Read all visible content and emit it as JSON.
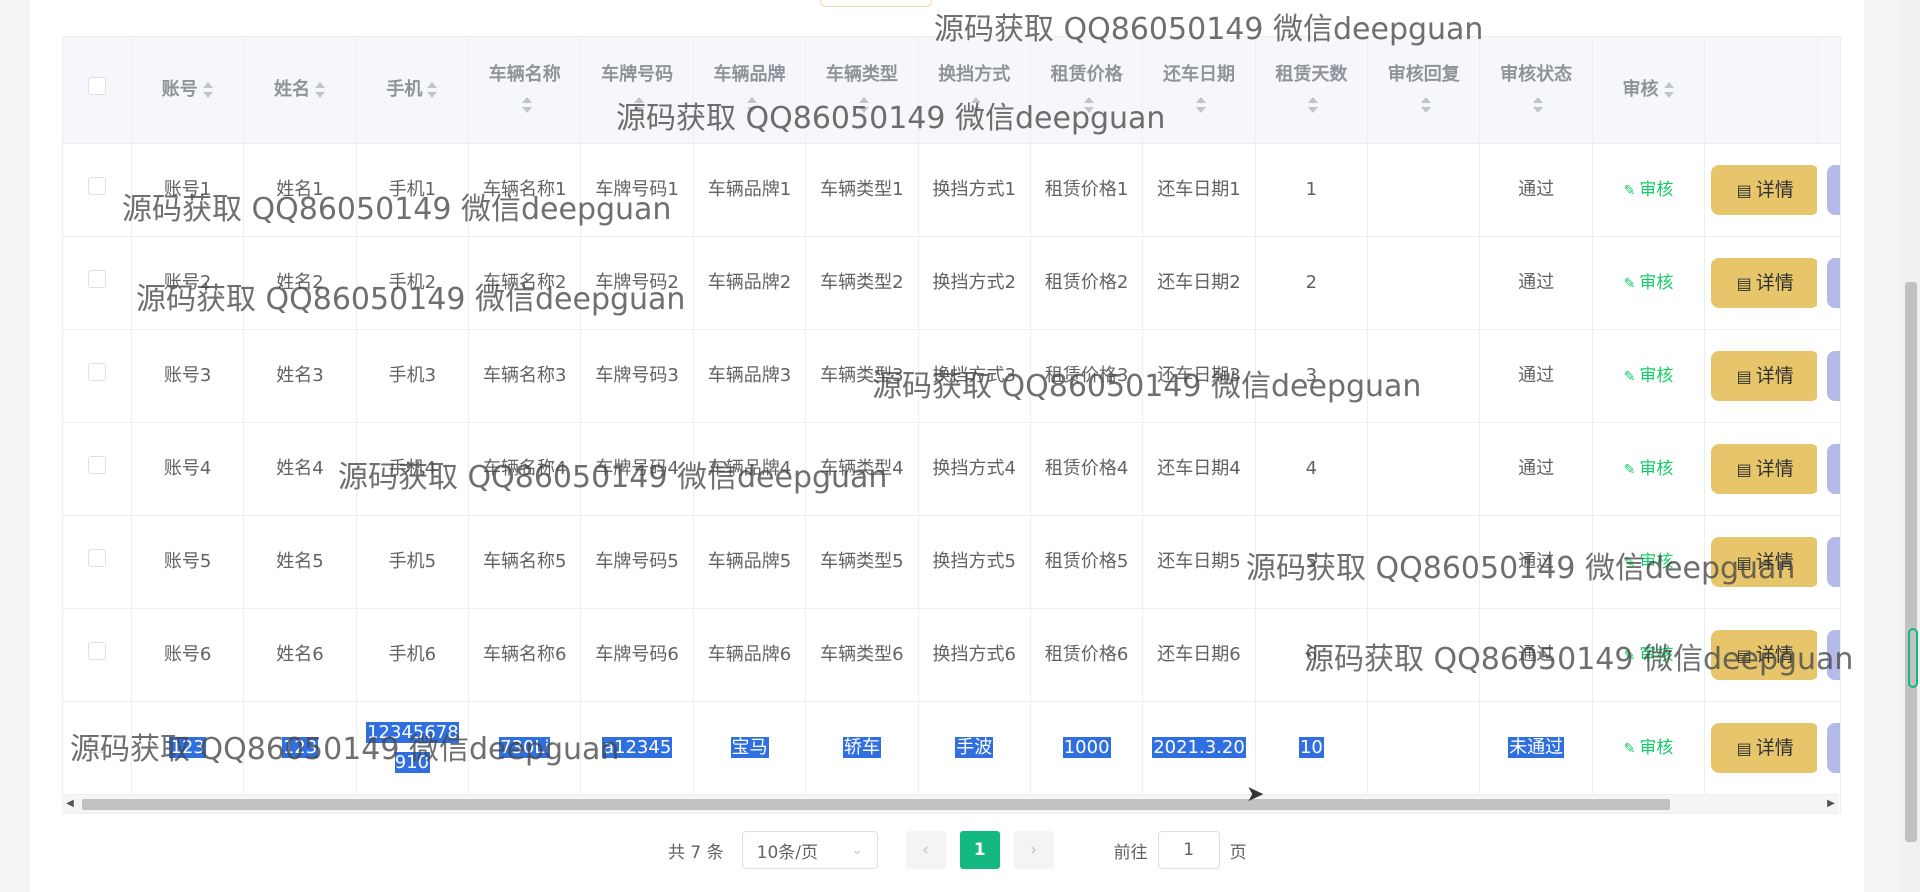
{
  "table": {
    "headers": {
      "account": "账号",
      "name": "姓名",
      "phone": "手机",
      "vehicle_name": "车辆名称",
      "plate": "车牌号码",
      "brand": "车辆品牌",
      "type": "车辆类型",
      "gear": "换挡方式",
      "price": "租赁价格",
      "return_date": "还车日期",
      "days": "租赁天数",
      "reply": "审核回复",
      "status": "审核状态",
      "audit": "审核"
    },
    "rows": [
      {
        "account": "账号1",
        "name": "姓名1",
        "phone": "手机1",
        "vehicle_name": "车辆名称1",
        "plate": "车牌号码1",
        "brand": "车辆品牌1",
        "type": "车辆类型1",
        "gear": "换挡方式1",
        "price": "租赁价格1",
        "return_date": "还车日期1",
        "days": "1",
        "reply": "",
        "status": "通过"
      },
      {
        "account": "账号2",
        "name": "姓名2",
        "phone": "手机2",
        "vehicle_name": "车辆名称2",
        "plate": "车牌号码2",
        "brand": "车辆品牌2",
        "type": "车辆类型2",
        "gear": "换挡方式2",
        "price": "租赁价格2",
        "return_date": "还车日期2",
        "days": "2",
        "reply": "",
        "status": "通过"
      },
      {
        "account": "账号3",
        "name": "姓名3",
        "phone": "手机3",
        "vehicle_name": "车辆名称3",
        "plate": "车牌号码3",
        "brand": "车辆品牌3",
        "type": "车辆类型3",
        "gear": "换挡方式3",
        "price": "租赁价格3",
        "return_date": "还车日期3",
        "days": "3",
        "reply": "",
        "status": "通过"
      },
      {
        "account": "账号4",
        "name": "姓名4",
        "phone": "手机4",
        "vehicle_name": "车辆名称4",
        "plate": "车牌号码4",
        "brand": "车辆品牌4",
        "type": "车辆类型4",
        "gear": "换挡方式4",
        "price": "租赁价格4",
        "return_date": "还车日期4",
        "days": "4",
        "reply": "",
        "status": "通过"
      },
      {
        "account": "账号5",
        "name": "姓名5",
        "phone": "手机5",
        "vehicle_name": "车辆名称5",
        "plate": "车牌号码5",
        "brand": "车辆品牌5",
        "type": "车辆类型5",
        "gear": "换挡方式5",
        "price": "租赁价格5",
        "return_date": "还车日期5",
        "days": "5",
        "reply": "",
        "status": "通过"
      },
      {
        "account": "账号6",
        "name": "姓名6",
        "phone": "手机6",
        "vehicle_name": "车辆名称6",
        "plate": "车牌号码6",
        "brand": "车辆品牌6",
        "type": "车辆类型6",
        "gear": "换挡方式6",
        "price": "租赁价格6",
        "return_date": "还车日期6",
        "days": "6",
        "reply": "",
        "status": "通过"
      },
      {
        "account": "123",
        "name": "123",
        "phone": "12345678910",
        "vehicle_name": "730Li",
        "plate": "a12345",
        "brand": "宝马",
        "type": "轿车",
        "gear": "手波",
        "price": "1000",
        "return_date": "2021.3.20",
        "days": "10",
        "reply": "",
        "status": "未通过",
        "highlighted": true
      }
    ],
    "audit_link_label": "审核",
    "detail_button_label": "详情"
  },
  "pagination": {
    "total_text": "共 7 条",
    "page_size": "10条/页",
    "current_page": "1",
    "goto_label": "前往",
    "goto_value": "1",
    "page_unit": "页"
  },
  "watermark_text": "源码获取 QQ86050149 微信deepguan",
  "colors": {
    "accent_green": "#13b97f",
    "detail_button": "#e6c56b",
    "selection": "#2f6fe0"
  }
}
